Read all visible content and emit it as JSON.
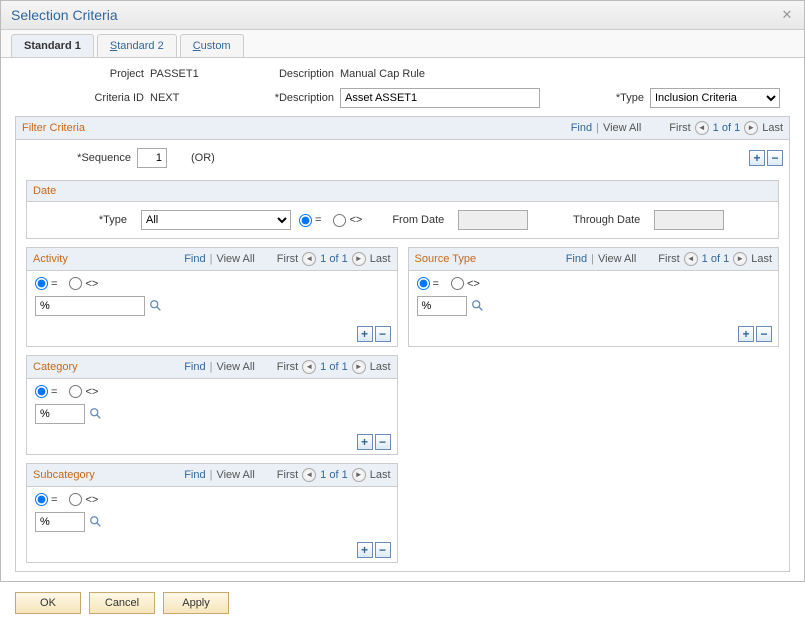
{
  "title": "Selection Criteria",
  "tabs": {
    "standard1": "Standard 1",
    "standard2": "Standard 2",
    "custom": "Custom"
  },
  "labels": {
    "project": "Project",
    "description": "Description",
    "criteria_id": "Criteria ID",
    "req_description": "Description",
    "type": "Type",
    "sequence": "Sequence",
    "or": "(OR)",
    "from_date": "From Date",
    "through_date": "Through Date"
  },
  "values": {
    "project": "PASSET1",
    "description": "Manual Cap Rule",
    "criteria_id": "NEXT",
    "req_description": "Asset ASSET1",
    "type": "Inclusion Criteria",
    "sequence": "1",
    "date_type": "All",
    "activity_val": "%",
    "source_type_val": "%",
    "category_val": "%",
    "subcategory_val": "%",
    "boxval_placeholder": ""
  },
  "sections": {
    "filter": "Filter Criteria",
    "date": "Date",
    "activity": "Activity",
    "source_type": "Source Type",
    "category": "Category",
    "subcategory": "Subcategory"
  },
  "nav": {
    "find": "Find",
    "view_all": "View All",
    "first": "First",
    "count": "1 of 1",
    "last": "Last"
  },
  "radio": {
    "eq": "=",
    "neq": "<>"
  },
  "buttons": {
    "ok": "OK",
    "cancel": "Cancel",
    "apply": "Apply"
  },
  "pm": {
    "plus": "+",
    "minus": "−"
  }
}
